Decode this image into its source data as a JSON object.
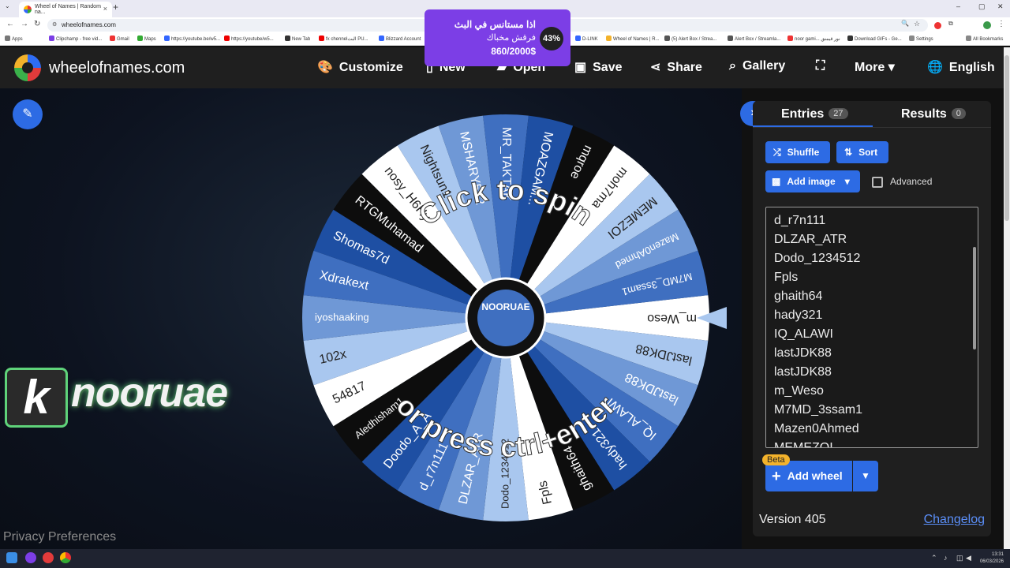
{
  "browser": {
    "tab_title": "Wheel of Names | Random na...",
    "url": "wheelofnames.com",
    "bookmarks": [
      "Apps",
      "Clipchamp - free vid...",
      "Gmail",
      "Maps",
      "https://youtube.be/w5...",
      "https://youtube/w5...",
      "New Tab",
      "fx chennelالبث PU...",
      "Blizzard Account",
      "D-LINK",
      "Wheel of Names | R...",
      "(5) Alert Box / Strea...",
      "Alert Box / Streamla...",
      "noor gami... نور قيمنق",
      "Download GIFs - Ge...",
      "Settings",
      "All Bookmarks"
    ]
  },
  "header": {
    "site_name": "wheelofnames.com",
    "nav": {
      "customize": "Customize",
      "new": "New",
      "open": "Open",
      "save": "Save",
      "share": "Share",
      "gallery": "Gallery",
      "more": "More",
      "language": "English"
    }
  },
  "ad": {
    "line1": "اذا مستانس في البث",
    "line2": "فرقش مخباك",
    "progress": "860/2000$",
    "percent": "43%"
  },
  "wheel": {
    "center_text_top": "Click to spin",
    "center_text_bottom": "or press ctrl+enter",
    "center_logo": "NOORUAE",
    "segments": [
      "m_Weso",
      "lastJDK88",
      "lastJDK88",
      "IQ_ALAWI",
      "hady321",
      "ghaith64",
      "Fpls",
      "Dodo_1234512",
      "DLZAR_ATR",
      "d_r7n111",
      "Doodo_A_A",
      "Aledhisham1",
      "54817",
      "102x",
      "iyoshaaking",
      "Xdrakext",
      "Shomas7d",
      "RTGMuhamad",
      "nosy_H6Hy",
      "Nightsun1",
      "MSHARY512",
      "MR_TAKTAK",
      "MOAZGAM...",
      "mqroe",
      "moh7ma",
      "MEMEZOI",
      "Mazen0Ahmed",
      "M7MD_3ssam1"
    ],
    "colors": [
      "#ffffff",
      "#a9c7ef",
      "#6f98d6",
      "#3f6fc0",
      "#1e4fa3",
      "#0d0d0d"
    ]
  },
  "stage": {
    "brand_letter": "k",
    "brand_name": "nooruae",
    "privacy": "Privacy Preferences"
  },
  "panel": {
    "tab_entries": "Entries",
    "entries_count": "27",
    "tab_results": "Results",
    "results_count": "0",
    "shuffle": "Shuffle",
    "sort": "Sort",
    "add_image": "Add image",
    "advanced": "Advanced",
    "entries": [
      "d_r7n111",
      "DLZAR_ATR",
      "Dodo_1234512",
      "Fpls",
      "ghaith64",
      "hady321",
      "IQ_ALAWI",
      "lastJDK88",
      "lastJDK88",
      "m_Weso",
      "M7MD_3ssam1",
      "Mazen0Ahmed",
      "MEMEZOI"
    ],
    "beta": "Beta",
    "add_wheel": "Add wheel",
    "version": "Version 405",
    "changelog": "Changelog"
  },
  "taskbar": {
    "time": "13:31",
    "date": "06/03/2026"
  }
}
